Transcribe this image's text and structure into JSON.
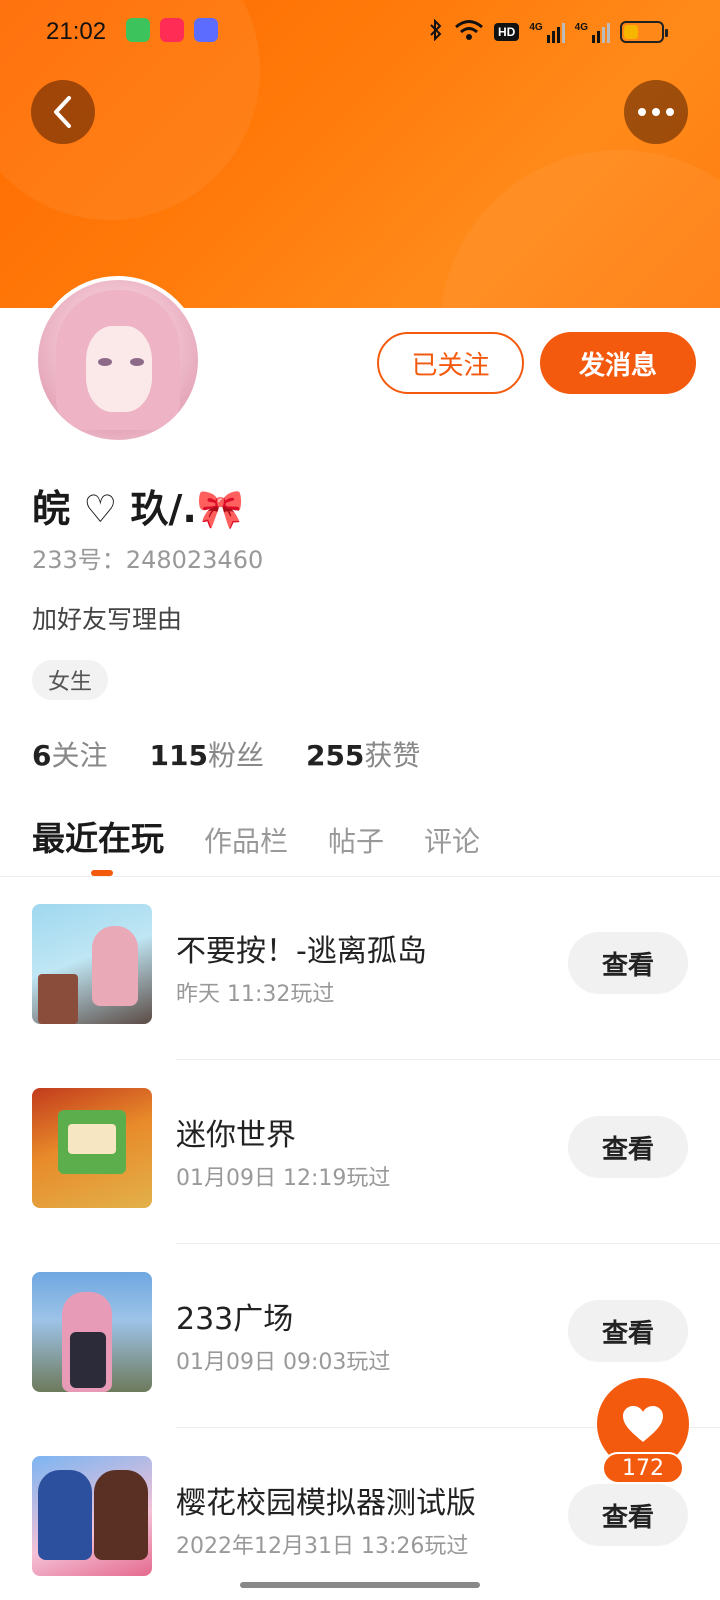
{
  "status_bar": {
    "time": "21:02",
    "icons": [
      "bluetooth-icon",
      "wifi-icon",
      "hd-icon",
      "signal-4g-icon",
      "signal-4g-icon",
      "battery-icon"
    ],
    "hd_label": "HD",
    "net_label": "4G",
    "battery_level": 0.4
  },
  "header": {
    "back_icon": "chevron-left-icon",
    "more_icon": "more-dots-icon"
  },
  "profile": {
    "nickname": "皖 ♡ 玖/.🎀",
    "user_id": "233号：248023460",
    "bio": "加好友写理由",
    "gender_tag": "女生",
    "followed_label": "已关注",
    "message_label": "发消息"
  },
  "stats": [
    {
      "num": "6",
      "label": "关注"
    },
    {
      "num": "115",
      "label": "粉丝"
    },
    {
      "num": "255",
      "label": "获赞"
    }
  ],
  "tabs": [
    {
      "label": "最近在玩",
      "active": true
    },
    {
      "label": "作品栏",
      "active": false
    },
    {
      "label": "帖子",
      "active": false
    },
    {
      "label": "评论",
      "active": false
    }
  ],
  "games": [
    {
      "name": "不要按！-逃离孤岛",
      "time": "昨天 11:32玩过",
      "view_label": "查看"
    },
    {
      "name": "迷你世界",
      "time": "01月09日 12:19玩过",
      "view_label": "查看"
    },
    {
      "name": "233广场",
      "time": "01月09日 09:03玩过",
      "view_label": "查看"
    },
    {
      "name": "樱花校园模拟器测试版",
      "time": "2022年12月31日 13:26玩过",
      "view_label": "查看"
    }
  ],
  "like": {
    "icon": "heart-icon",
    "count": "172"
  },
  "colors": {
    "accent": "#f45a0d",
    "header_gradient_start": "#ff6a00",
    "header_gradient_end": "#ff8a1a"
  }
}
